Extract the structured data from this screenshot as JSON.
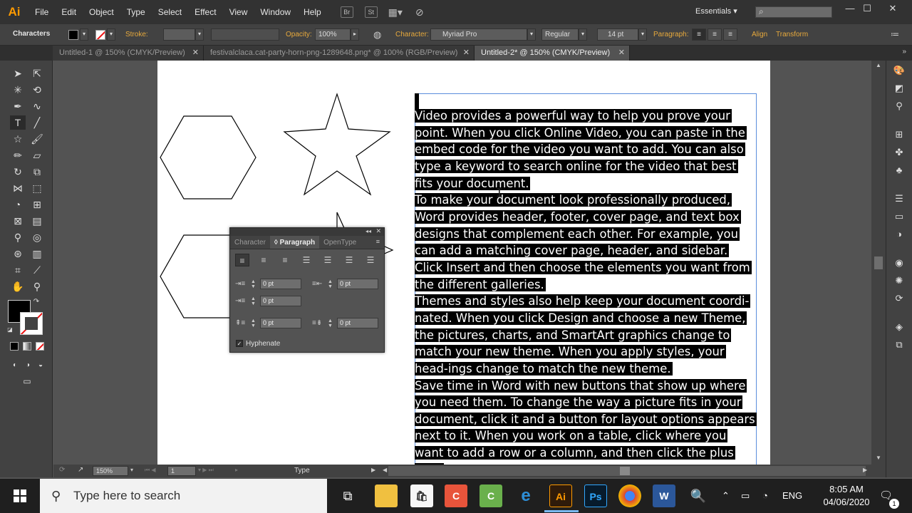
{
  "app": {
    "logo": "Ai",
    "workspace": "Essentials ▾"
  },
  "menu": [
    "File",
    "Edit",
    "Object",
    "Type",
    "Select",
    "Effect",
    "View",
    "Window",
    "Help"
  ],
  "menu_icons": [
    "Br",
    "St"
  ],
  "control_bar": {
    "context": "Characters",
    "stroke_label": "Stroke:",
    "opacity_label": "Opacity:",
    "opacity_value": "100%",
    "character_label": "Character:",
    "font_value": "Myriad Pro",
    "style_value": "Regular",
    "size_value": "14 pt",
    "paragraph_label": "Paragraph:",
    "align_link": "Align",
    "transform_link": "Transform"
  },
  "tabs": [
    {
      "label": "Untitled-1 @ 150% (CMYK/Preview)",
      "close": "✕"
    },
    {
      "label": "festivalclaca.cat-party-horn-png-1289648.png* @ 100% (RGB/Preview)",
      "close": "✕"
    },
    {
      "label": "Untitled-2* @ 150% (CMYK/Preview)",
      "close": "✕"
    }
  ],
  "paragraph_panel": {
    "tabs": [
      "Character",
      "◊ Paragraph",
      "OpenType"
    ],
    "fields": [
      "0 pt",
      "0 pt",
      "0 pt",
      "0 pt",
      "0 pt"
    ],
    "hyphenate_label": "Hyphenate",
    "hyphenate_check": "✓"
  },
  "text_paragraphs": [
    "Video provides a powerful way to help you prove your point. When you click Online Video, you can paste in the embed code for the video you want to add. You can also type a keyword to search online for the video that best fits your document.",
    "To make your document look professionally produced, Word provides header, footer, cover page, and text box designs that complement each other. For example, you can add a matching cover page, header, and sidebar. Click Insert and then choose the elements you want from the different galleries.",
    "Themes and styles also help keep your document coordi-nated. When you click Design and choose a new Theme, the pictures, charts, and SmartArt graphics change to match your new theme. When you apply styles, your head-ings change to match the new theme.",
    "Save time in Word with new buttons that show up where you need them. To change the way a picture fits in your document, click it and a button for layout options appears next to it. When you work on a table, click where you want to add a row or a column, and then click the plus sign."
  ],
  "status_bar": {
    "zoom": "150%",
    "page": "1",
    "tool": "Type"
  },
  "taskbar": {
    "search_placeholder": "Type here to search",
    "apps": [
      "Ai",
      "Ps",
      "W"
    ],
    "lang": "ENG",
    "time": "8:05 AM",
    "date": "04/06/2020",
    "notif_count": "1"
  },
  "colors": {
    "ai_orange": "#ff9a00",
    "selection_blue": "#5a8ddc",
    "text_highlight": "#000000"
  }
}
